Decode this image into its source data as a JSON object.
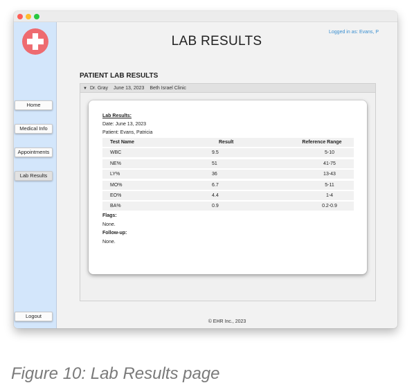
{
  "app": {
    "title": "LAB RESULTS",
    "logged_in": "Logged in as: Evans, P",
    "footer": "© EHR Inc., 2023"
  },
  "sidebar": {
    "items": [
      {
        "label": "Home",
        "active": false
      },
      {
        "label": "Medical Info",
        "active": false
      },
      {
        "label": "Appointments",
        "active": false
      },
      {
        "label": "Lab Results",
        "active": true
      }
    ],
    "logout": "Logout"
  },
  "section": {
    "heading": "PATIENT LAB RESULTS",
    "record": {
      "doctor": "Dr. Gray",
      "date": "June 13, 2023",
      "clinic": "Beth Israel Clinic"
    }
  },
  "report": {
    "title": "Lab Results:",
    "date_line": "Date: June 13, 2023",
    "patient_line": "Patient: Evans, Patricia",
    "columns": [
      "Test Name",
      "Result",
      "Reference Range"
    ],
    "rows": [
      {
        "test": "WBC",
        "result": "9.5",
        "range": "5-10"
      },
      {
        "test": "NE%",
        "result": "51",
        "range": "41-75"
      },
      {
        "test": "LY%",
        "result": "36",
        "range": "13-43"
      },
      {
        "test": "MO%",
        "result": "6.7",
        "range": "5-11"
      },
      {
        "test": "EO%",
        "result": "4.4",
        "range": "1-4"
      },
      {
        "test": "BA%",
        "result": "0.9",
        "range": "0.2-0.9"
      }
    ],
    "flags_label": "Flags:",
    "flags_value": "None.",
    "followup_label": "Follow-up:",
    "followup_value": "None."
  },
  "caption": "Figure 10: Lab Results page",
  "colors": {
    "sidebar": "#d3e6fb",
    "logo": "#ee6b70",
    "accent_link": "#3a8fd0"
  }
}
